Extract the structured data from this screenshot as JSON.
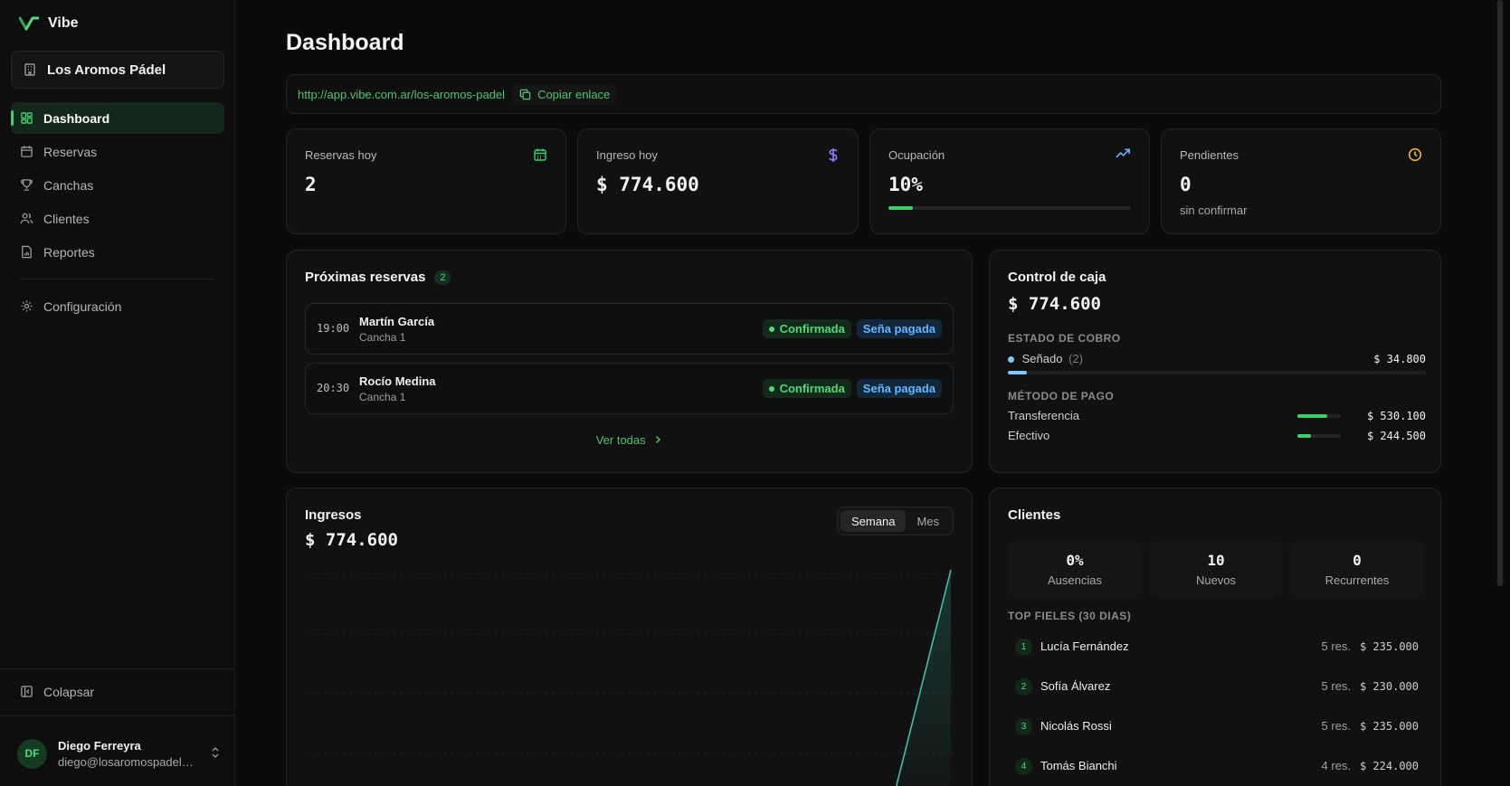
{
  "app": {
    "name": "Vibe"
  },
  "club": {
    "name": "Los Aromos Pádel"
  },
  "sidebar": {
    "items": [
      {
        "label": "Dashboard",
        "icon": "grid-icon",
        "active": true
      },
      {
        "label": "Reservas",
        "icon": "calendar-icon"
      },
      {
        "label": "Canchas",
        "icon": "trophy-icon"
      },
      {
        "label": "Clientes",
        "icon": "users-icon"
      },
      {
        "label": "Reportes",
        "icon": "file-chart-icon"
      }
    ],
    "settings": {
      "label": "Configuración",
      "icon": "gear-icon"
    },
    "collapse": {
      "label": "Colapsar",
      "icon": "panel-left-icon"
    }
  },
  "user": {
    "initials": "DF",
    "name": "Diego Ferreyra",
    "email": "diego@losaromospadel...."
  },
  "page": {
    "title": "Dashboard"
  },
  "link": {
    "url": "http://app.vibe.com.ar/los-aromos-padel",
    "copy_label": "Copiar enlace"
  },
  "stats": {
    "reservas": {
      "label": "Reservas hoy",
      "value": "2"
    },
    "ingreso": {
      "label": "Ingreso hoy",
      "value": "$ 774.600"
    },
    "ocupacion": {
      "label": "Ocupación",
      "value": "10%",
      "percent": 10
    },
    "pendientes": {
      "label": "Pendientes",
      "value": "0",
      "sub": "sin confirmar"
    }
  },
  "proximas": {
    "title": "Próximas reservas",
    "count": "2",
    "rows": [
      {
        "time": "19:00",
        "name": "Martín García",
        "court": "Cancha 1",
        "status": "Confirmada",
        "payment": "Seña pagada"
      },
      {
        "time": "20:30",
        "name": "Rocío Medina",
        "court": "Cancha 1",
        "status": "Confirmada",
        "payment": "Seña pagada"
      }
    ],
    "view_all": "Ver todas"
  },
  "caja": {
    "title": "Control de caja",
    "total": "$ 774.600",
    "estado_label": "ESTADO DE COBRO",
    "senado": {
      "label": "Señado",
      "count": "(2)",
      "amount": "$ 34.800",
      "fraction": 0.045
    },
    "metodo_label": "MÉTODO DE PAGO",
    "methods": [
      {
        "label": "Transferencia",
        "amount": "$ 530.100",
        "fraction": 0.68
      },
      {
        "label": "Efectivo",
        "amount": "$ 244.500",
        "fraction": 0.32
      }
    ]
  },
  "ingresos": {
    "title": "Ingresos",
    "total": "$ 774.600",
    "tabs": [
      {
        "label": "Semana",
        "active": true
      },
      {
        "label": "Mes",
        "active": false
      }
    ],
    "line_color": "#3fbfa8"
  },
  "clientes": {
    "title": "Clientes",
    "stats": [
      {
        "value": "0%",
        "label": "Ausencias"
      },
      {
        "value": "10",
        "label": "Nuevos"
      },
      {
        "value": "0",
        "label": "Recurrentes"
      }
    ],
    "top_label": "TOP FIELES (30 DIAS)",
    "top": [
      {
        "rank": "1",
        "name": "Lucía Fernández",
        "res": "5 res.",
        "amount": "$ 235.000"
      },
      {
        "rank": "2",
        "name": "Sofía Álvarez",
        "res": "5 res.",
        "amount": "$ 230.000"
      },
      {
        "rank": "3",
        "name": "Nicolás Rossi",
        "res": "5 res.",
        "amount": "$ 235.000"
      },
      {
        "rank": "4",
        "name": "Tomás Bianchi",
        "res": "4 res.",
        "amount": "$ 224.000"
      }
    ]
  },
  "colors": {
    "accent": "#3ecf6a",
    "info": "#63b6ff",
    "warning": "#f5b52e",
    "purple": "#8b7cf6",
    "background": "#0b0b0b"
  }
}
